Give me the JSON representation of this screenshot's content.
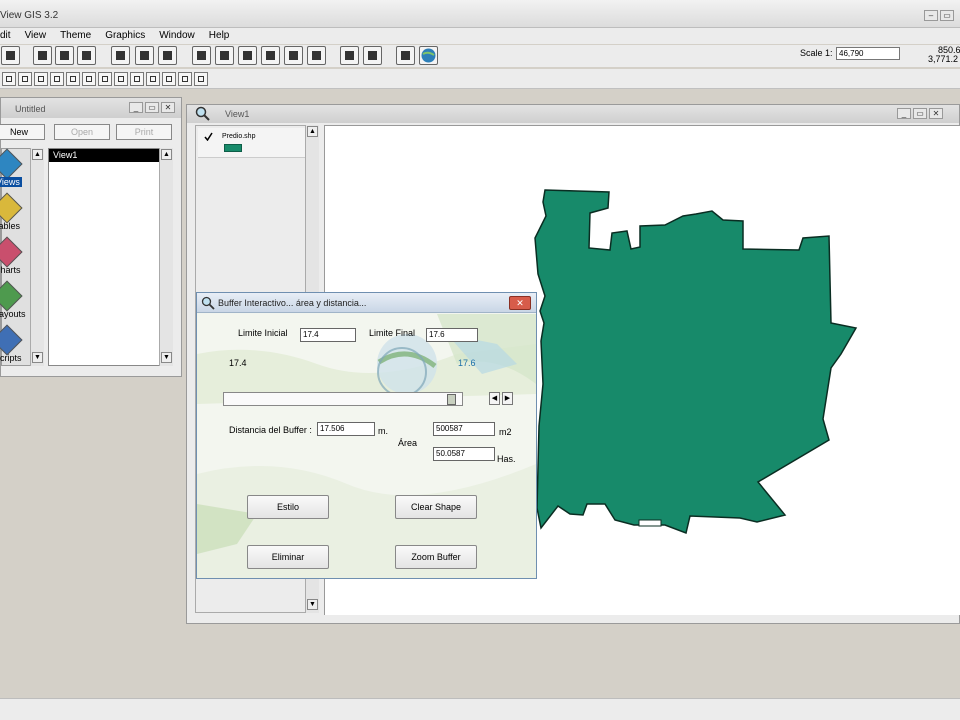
{
  "app": {
    "title": "View GIS 3.2"
  },
  "menu": [
    "dit",
    "View",
    "Theme",
    "Graphics",
    "Window",
    "Help"
  ],
  "toolbar": {
    "scale_label": "Scale 1:",
    "scale_value": "46,790",
    "coord_x": "850.6",
    "coord_y": "3,771.2"
  },
  "project": {
    "title": "Untitled",
    "buttons": {
      "new": "New",
      "open": "Open",
      "print": "Print"
    },
    "docs": [
      {
        "label": "Views",
        "selected": true,
        "color": "#2e86c1"
      },
      {
        "label": "Tables",
        "selected": false,
        "color": "#d9b83b"
      },
      {
        "label": "Charts",
        "selected": false,
        "color": "#c94f6d"
      },
      {
        "label": "Layouts",
        "selected": false,
        "color": "#4e9a4e"
      },
      {
        "label": "Scripts",
        "selected": false,
        "color": "#3f6fb5"
      }
    ],
    "items": [
      "View1"
    ]
  },
  "view": {
    "title": "View1",
    "theme": {
      "name": "Predio.shp",
      "color": "#178a6a",
      "visible": true
    }
  },
  "dialog": {
    "title": "Buffer Interactivo... área y distancia...",
    "limite_inicial_label": "Limite Inicial",
    "limite_inicial": "17.4",
    "limite_final_label": "Limite Final",
    "limite_final": "17.6",
    "slider_min_label": "17.4",
    "slider_max_label": "17.6",
    "slider_position": 0.97,
    "distancia_label": "Distancia del Buffer :",
    "distancia_value": "17.506",
    "distancia_unit": "m.",
    "area_label": "Área",
    "area_m2": "500587",
    "area_m2_unit": "m2",
    "area_has": "50.0587",
    "area_has_unit": "Has.",
    "buttons": {
      "estilo": "Estilo",
      "clear_shape": "Clear Shape",
      "eliminar": "Eliminar",
      "zoom_buffer": "Zoom Buffer"
    }
  }
}
